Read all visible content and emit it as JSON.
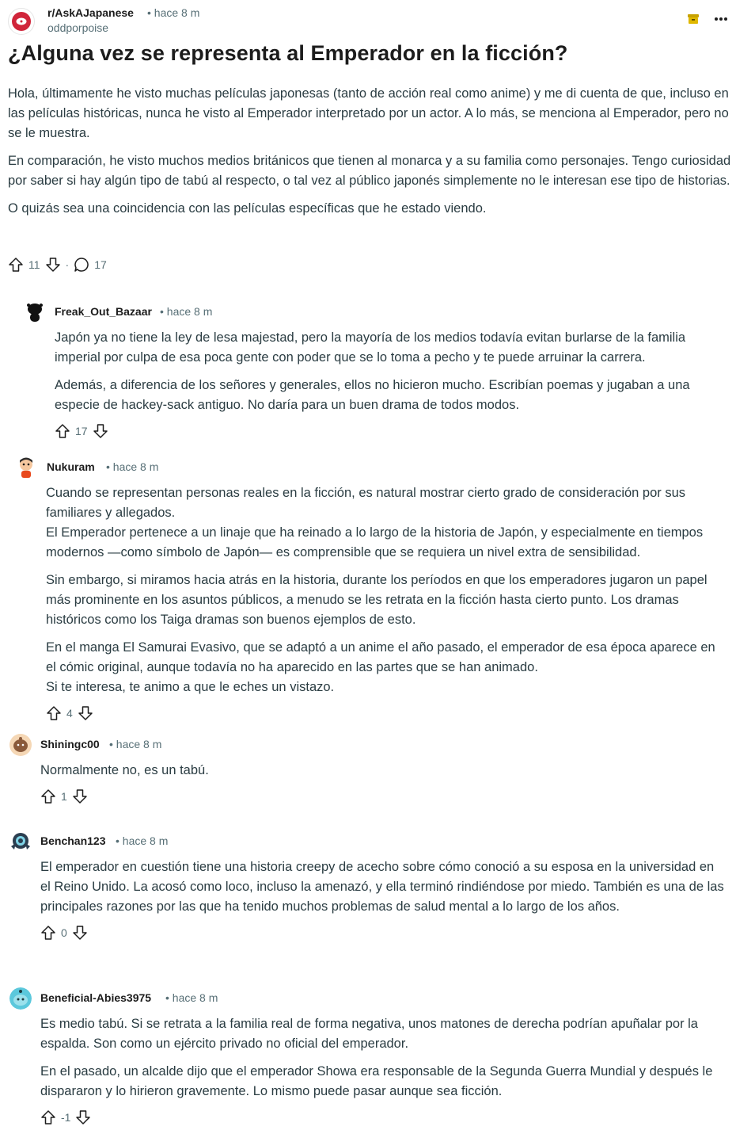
{
  "post": {
    "subreddit": "r/AskAJapanese",
    "time": "• hace 8 m",
    "author": "oddporpoise",
    "title": "¿Alguna vez se representa al Emperador en la ficción?",
    "paragraphs": [
      "Hola, últimamente he visto muchas películas japonesas (tanto de acción real como anime) y me di cuenta de que, incluso en las películas históricas, nunca he visto al Emperador interpretado por un actor. A lo más, se menciona al Emperador, pero no se le muestra.",
      "En comparación, he visto muchos medios británicos que tienen al monarca y a su familia como personajes. Tengo curiosidad por saber si hay algún tipo de tabú al respecto, o tal vez al público japonés simplemente no le interesan ese tipo de historias.",
      "O quizás sea una coincidencia con las películas específicas que he estado viendo."
    ],
    "votes": "11",
    "separator": "·",
    "comments": "17",
    "icons": {
      "upvote": "upvote-arrow-icon",
      "downvote": "downvote-arrow-icon",
      "comment": "comment-bubble-icon",
      "archive": "archive-icon",
      "more": "more-dots-icon"
    }
  },
  "comments": [
    {
      "author": "Freak_Out_Bazaar",
      "time": "• hace 8 m",
      "paragraphs": [
        "Japón ya no tiene la ley de lesa majestad, pero la mayoría de los medios todavía evitan burlarse de la familia imperial por culpa de esa poca gente con poder que se lo toma a pecho y te puede arruinar la carrera.",
        "Además, a diferencia de los señores y generales, ellos no hicieron mucho. Escribían poemas y jugaban a una especie de hackey-sack antiguo. No daría para un buen drama de todos modos."
      ],
      "votes": "17"
    },
    {
      "author": "Nukuram",
      "time": "• hace 8 m",
      "paragraphs": [
        "Cuando se representan personas reales en la ficción, es natural mostrar cierto grado de consideración por sus familiares y allegados.\nEl Emperador pertenece a un linaje que ha reinado a lo largo de la historia de Japón, y especialmente en tiempos modernos —como símbolo de Japón— es comprensible que se requiera un nivel extra de sensibilidad.",
        "Sin embargo, si miramos hacia atrás en la historia, durante los períodos en que los emperadores jugaron un papel más prominente en los asuntos públicos, a menudo se les retrata en la ficción hasta cierto punto. Los dramas históricos como los Taiga dramas son buenos ejemplos de esto.",
        "En el manga El Samurai Evasivo, que se adaptó a un anime el año pasado, el emperador de esa época aparece en el cómic original, aunque todavía no ha aparecido en las partes que se han animado.\nSi te interesa, te animo a que le eches un vistazo."
      ],
      "votes": "4"
    },
    {
      "author": "Shiningc00",
      "time": "• hace 8 m",
      "paragraphs": [
        "Normalmente no, es un tabú."
      ],
      "votes": "1"
    },
    {
      "author": "Benchan123",
      "time": "• hace 8 m",
      "paragraphs": [
        "El emperador en cuestión tiene una historia creepy de acecho sobre cómo conoció a su esposa en la universidad en el Reino Unido. La acosó como loco, incluso la amenazó, y ella terminó rindiéndose por miedo. También es una de las principales razones por las que ha tenido muchos problemas de salud mental a lo largo de los años."
      ],
      "votes": "0"
    },
    {
      "author": "Beneficial-Abies3975",
      "time": "• hace 8 m",
      "paragraphs": [
        "Es medio tabú. Si se retrata a la familia real de forma negativa, unos matones de derecha podrían apuñalar por la espalda. Son como un ejército privado no oficial del emperador.",
        "En el pasado, un alcalde dijo que el emperador Showa era responsable de la Segunda Guerra Mundial y después le dispararon y lo hirieron gravemente. Lo mismo puede pasar aunque sea ficción."
      ],
      "votes": "-1"
    }
  ],
  "colors": {
    "text": "#2a3c42",
    "meta": "#576f76",
    "brand": "#d93a00",
    "archive": "#c8a200"
  }
}
